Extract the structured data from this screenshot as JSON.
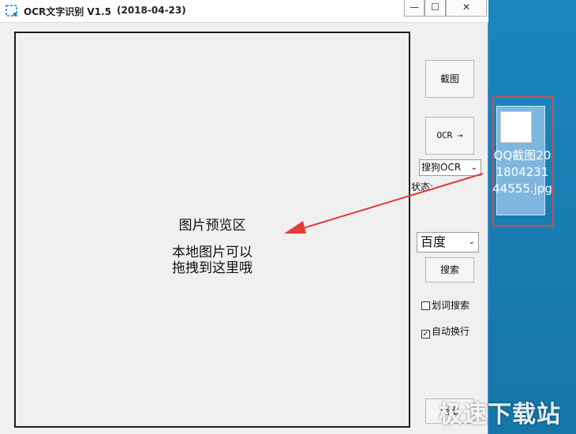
{
  "window": {
    "title": "OCR文字识别 V1.5",
    "date": "(2018-04-23)",
    "minimize": "—",
    "maximize": "☐",
    "close": "✕"
  },
  "preview": {
    "title": "图片预览区",
    "hint_line1": "本地图片可以",
    "hint_line2": "拖拽到这里哦"
  },
  "controls": {
    "capture_label": "截图",
    "ocr_label": "OCR →",
    "engine_selected": "搜狗OCR",
    "status_label": "状态:",
    "site_selected": "百度",
    "search_label": "搜索",
    "word_search_label": "划词搜索",
    "word_search_checked": false,
    "auto_wrap_label": "自动换行",
    "auto_wrap_checked": true,
    "exit_label": "退出"
  },
  "desktop": {
    "file_name": "QQ截图20180423144555.jpg"
  },
  "watermark": "极速下载站",
  "colors": {
    "desktop": "#1a7fb3",
    "highlight_border": "#e04545",
    "arrow": "#e23b3b"
  }
}
